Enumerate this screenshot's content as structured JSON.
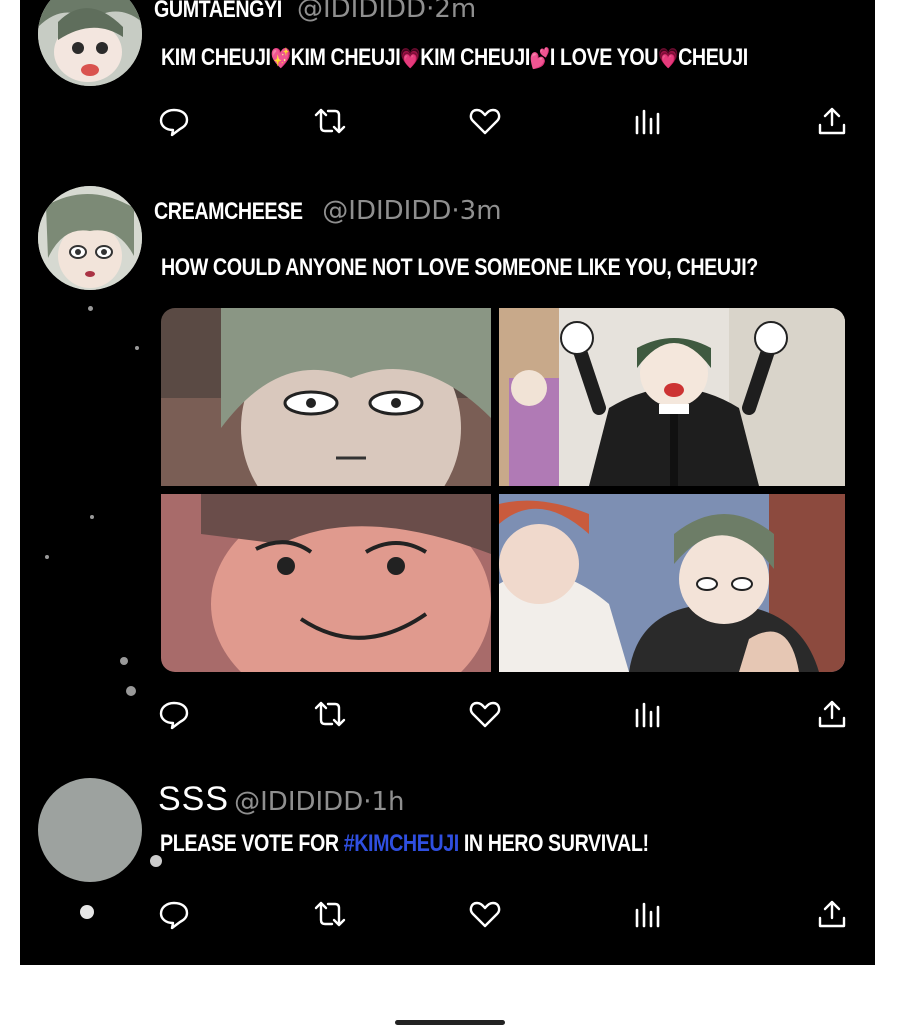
{
  "tweets": [
    {
      "username": "GUMTAENGYI",
      "handle": "@IDIDIDD",
      "time": "2m",
      "text_parts": [
        "KIM CHEUJI",
        "KIM CHEUJI",
        "KIM CHEUJI",
        "I LOVE YOU",
        "CHEUJI"
      ],
      "emojis": [
        "💖",
        "💗",
        "💕",
        "💗"
      ]
    },
    {
      "username": "CREAMCHEESE",
      "handle": "@IDIDIDD",
      "time": "3m",
      "text": "HOW COULD ANYONE NOT LOVE SOMEONE LIKE YOU, CHEUJI?"
    },
    {
      "username": "SSS",
      "handle": "@IDIDIDD",
      "time": "1h",
      "text_before": "PLEASE VOTE FOR ",
      "hashtag": "#KIMCHEUJI",
      "text_after": " IN HERO SURVIVAL!"
    }
  ],
  "meta_separator": "·",
  "action_icons": [
    "reply-icon",
    "retweet-icon",
    "like-icon",
    "views-icon",
    "share-icon"
  ],
  "colors": {
    "background": "#000000",
    "text": "#ffffff",
    "meta": "#8f8f8f",
    "hashtag": "#2f4fe0"
  }
}
